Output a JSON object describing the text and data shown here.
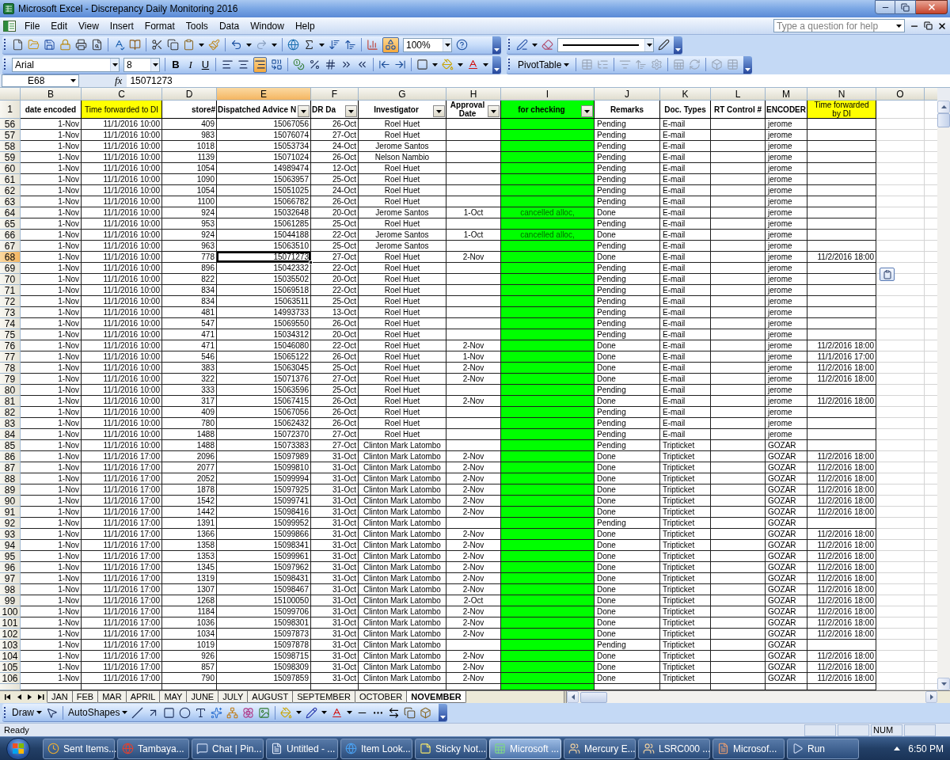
{
  "window": {
    "title": "Microsoft Excel - Discrepancy Daily Monitoring 2016"
  },
  "menu": [
    "File",
    "Edit",
    "View",
    "Insert",
    "Format",
    "Tools",
    "Data",
    "Window",
    "Help"
  ],
  "help_search": {
    "placeholder": "Type a question for help"
  },
  "standard_toolbar": {
    "zoom": "100%",
    "drawing_button": {
      "selected": true
    }
  },
  "formatting_toolbar": {
    "font": "Arial",
    "size": "8",
    "style_buttons": [
      "B",
      "I",
      "U"
    ],
    "align_buttons": [
      {
        "kind": "left",
        "selected": false
      },
      {
        "kind": "center",
        "selected": false
      },
      {
        "kind": "right",
        "selected": true
      }
    ]
  },
  "pivot_toolbar": {
    "label": "PivotTable"
  },
  "formula_bar": {
    "name_box": "E68",
    "function_label": "fx",
    "value": "15071273"
  },
  "header_row": {
    "row": "1"
  },
  "columns": [
    {
      "letter": "B",
      "heading": "date encoded",
      "selected": false,
      "filter": false
    },
    {
      "letter": "C",
      "heading": "Time forwarded to DI",
      "selected": false,
      "filter": false,
      "color": "#ffff00"
    },
    {
      "letter": "D",
      "heading": "store#",
      "selected": false,
      "filter": false
    },
    {
      "letter": "E",
      "heading": "Dispatched Advice N",
      "selected": true,
      "filter": true
    },
    {
      "letter": "F",
      "heading": "DR Da",
      "selected": false,
      "filter": true
    },
    {
      "letter": "G",
      "heading": "Investigator",
      "selected": false,
      "filter": true
    },
    {
      "letter": "H",
      "heading": "Approval Date",
      "selected": false,
      "filter": true
    },
    {
      "letter": "I",
      "heading": "for checking",
      "selected": false,
      "filter": true,
      "color": "#00ff00",
      "cell_fill": {
        "color": "#00ff00"
      }
    },
    {
      "letter": "J",
      "heading": "Remarks",
      "selected": false,
      "filter": false
    },
    {
      "letter": "K",
      "heading": "Doc. Types",
      "selected": false,
      "filter": false
    },
    {
      "letter": "L",
      "heading": "RT Control #",
      "selected": false,
      "filter": false
    },
    {
      "letter": "M",
      "heading": "ENCODER",
      "selected": false,
      "filter": false
    },
    {
      "letter": "N",
      "heading": "Time forwarded by DI",
      "selected": false,
      "filter": false,
      "color": "#ffff00"
    },
    {
      "letter": "O",
      "selected": false,
      "filter": false
    }
  ],
  "rows": [
    {
      "row": "56",
      "selected": false,
      "date_encoded": "1-Nov",
      "time_forwarded": "11/1/2016 10:00",
      "store": "409",
      "dispatched_advice": "15067056",
      "dr_date": "26-Oct",
      "investigator": "Roel Huet",
      "remarks": "Pending",
      "doc_type": "E-mail",
      "encoder": "jerome"
    },
    {
      "row": "57",
      "selected": false,
      "date_encoded": "1-Nov",
      "time_forwarded": "11/1/2016 10:00",
      "store": "983",
      "dispatched_advice": "15076074",
      "dr_date": "27-Oct",
      "investigator": "Roel Huet",
      "remarks": "Pending",
      "doc_type": "E-mail",
      "encoder": "jerome"
    },
    {
      "row": "58",
      "selected": false,
      "date_encoded": "1-Nov",
      "time_forwarded": "11/1/2016 10:00",
      "store": "1018",
      "dispatched_advice": "15053734",
      "dr_date": "24-Oct",
      "investigator": "Jerome Santos",
      "remarks": "Pending",
      "doc_type": "E-mail",
      "encoder": "jerome"
    },
    {
      "row": "59",
      "selected": false,
      "date_encoded": "1-Nov",
      "time_forwarded": "11/1/2016 10:00",
      "store": "1139",
      "dispatched_advice": "15071024",
      "dr_date": "26-Oct",
      "investigator": "Nelson Nambio",
      "remarks": "Pending",
      "doc_type": "E-mail",
      "encoder": "jerome"
    },
    {
      "row": "60",
      "selected": false,
      "date_encoded": "1-Nov",
      "time_forwarded": "11/1/2016 10:00",
      "store": "1054",
      "dispatched_advice": "14989474",
      "dr_date": "12-Oct",
      "investigator": "Roel Huet",
      "remarks": "Pending",
      "doc_type": "E-mail",
      "encoder": "jerome"
    },
    {
      "row": "61",
      "selected": false,
      "date_encoded": "1-Nov",
      "time_forwarded": "11/1/2016 10:00",
      "store": "1090",
      "dispatched_advice": "15063957",
      "dr_date": "25-Oct",
      "investigator": "Roel Huet",
      "remarks": "Pending",
      "doc_type": "E-mail",
      "encoder": "jerome"
    },
    {
      "row": "62",
      "selected": false,
      "date_encoded": "1-Nov",
      "time_forwarded": "11/1/2016 10:00",
      "store": "1054",
      "dispatched_advice": "15051025",
      "dr_date": "24-Oct",
      "investigator": "Roel Huet",
      "remarks": "Pending",
      "doc_type": "E-mail",
      "encoder": "jerome"
    },
    {
      "row": "63",
      "selected": false,
      "date_encoded": "1-Nov",
      "time_forwarded": "11/1/2016 10:00",
      "store": "1100",
      "dispatched_advice": "15066782",
      "dr_date": "26-Oct",
      "investigator": "Roel Huet",
      "remarks": "Pending",
      "doc_type": "E-mail",
      "encoder": "jerome"
    },
    {
      "row": "64",
      "selected": false,
      "date_encoded": "1-Nov",
      "time_forwarded": "11/1/2016 10:00",
      "store": "924",
      "dispatched_advice": "15032648",
      "dr_date": "20-Oct",
      "investigator": "Jerome Santos",
      "approval_date": "1-Oct",
      "for_checking": "cancelled alloc,",
      "remarks": "Done",
      "doc_type": "E-mail",
      "encoder": "jerome"
    },
    {
      "row": "65",
      "selected": false,
      "date_encoded": "1-Nov",
      "time_forwarded": "11/1/2016 10:00",
      "store": "953",
      "dispatched_advice": "15061285",
      "dr_date": "25-Oct",
      "investigator": "Roel Huet",
      "remarks": "Pending",
      "doc_type": "E-mail",
      "encoder": "jerome"
    },
    {
      "row": "66",
      "selected": false,
      "date_encoded": "1-Nov",
      "time_forwarded": "11/1/2016 10:00",
      "store": "924",
      "dispatched_advice": "15044188",
      "dr_date": "22-Oct",
      "investigator": "Jerome Santos",
      "approval_date": "1-Oct",
      "for_checking": "cancelled alloc,",
      "remarks": "Done",
      "doc_type": "E-mail",
      "encoder": "jerome"
    },
    {
      "row": "67",
      "selected": false,
      "date_encoded": "1-Nov",
      "time_forwarded": "11/1/2016 10:00",
      "store": "963",
      "dispatched_advice": "15063510",
      "dr_date": "25-Oct",
      "investigator": "Jerome Santos",
      "remarks": "Pending",
      "doc_type": "E-mail",
      "encoder": "jerome"
    },
    {
      "row": "68",
      "selected": true,
      "date_encoded": "1-Nov",
      "time_forwarded": "11/1/2016 10:00",
      "store": "778",
      "dispatched_advice": "15071273",
      "dr_date": "27-Oct",
      "investigator": "Roel Huet",
      "approval_date": "2-Nov",
      "remarks": "Done",
      "doc_type": "E-mail",
      "encoder": "jerome",
      "time_forwarded_by_di": "11/2/2016 18:00"
    },
    {
      "row": "69",
      "selected": false,
      "date_encoded": "1-Nov",
      "time_forwarded": "11/1/2016 10:00",
      "store": "896",
      "dispatched_advice": "15042332",
      "dr_date": "22-Oct",
      "investigator": "Roel Huet",
      "remarks": "Pending",
      "doc_type": "E-mail",
      "encoder": "jerome"
    },
    {
      "row": "70",
      "selected": false,
      "date_encoded": "1-Nov",
      "time_forwarded": "11/1/2016 10:00",
      "store": "822",
      "dispatched_advice": "15035502",
      "dr_date": "20-Oct",
      "investigator": "Roel Huet",
      "remarks": "Pending",
      "doc_type": "E-mail",
      "encoder": "jerome"
    },
    {
      "row": "71",
      "selected": false,
      "date_encoded": "1-Nov",
      "time_forwarded": "11/1/2016 10:00",
      "store": "834",
      "dispatched_advice": "15069518",
      "dr_date": "22-Oct",
      "investigator": "Roel Huet",
      "remarks": "Pending",
      "doc_type": "E-mail",
      "encoder": "jerome"
    },
    {
      "row": "72",
      "selected": false,
      "date_encoded": "1-Nov",
      "time_forwarded": "11/1/2016 10:00",
      "store": "834",
      "dispatched_advice": "15063511",
      "dr_date": "25-Oct",
      "investigator": "Roel Huet",
      "remarks": "Pending",
      "doc_type": "E-mail",
      "encoder": "jerome"
    },
    {
      "row": "73",
      "selected": false,
      "date_encoded": "1-Nov",
      "time_forwarded": "11/1/2016 10:00",
      "store": "481",
      "dispatched_advice": "14993733",
      "dr_date": "13-Oct",
      "investigator": "Roel Huet",
      "remarks": "Pending",
      "doc_type": "E-mail",
      "encoder": "jerome"
    },
    {
      "row": "74",
      "selected": false,
      "date_encoded": "1-Nov",
      "time_forwarded": "11/1/2016 10:00",
      "store": "547",
      "dispatched_advice": "15069550",
      "dr_date": "26-Oct",
      "investigator": "Roel Huet",
      "remarks": "Pending",
      "doc_type": "E-mail",
      "encoder": "jerome"
    },
    {
      "row": "75",
      "selected": false,
      "date_encoded": "1-Nov",
      "time_forwarded": "11/1/2016 10:00",
      "store": "471",
      "dispatched_advice": "15034312",
      "dr_date": "20-Oct",
      "investigator": "Roel Huet",
      "remarks": "Pending",
      "doc_type": "E-mail",
      "encoder": "jerome"
    },
    {
      "row": "76",
      "selected": false,
      "date_encoded": "1-Nov",
      "time_forwarded": "11/1/2016 10:00",
      "store": "471",
      "dispatched_advice": "15046080",
      "dr_date": "22-Oct",
      "investigator": "Roel Huet",
      "approval_date": "2-Nov",
      "remarks": "Done",
      "doc_type": "E-mail",
      "encoder": "jerome",
      "time_forwarded_by_di": "11/2/2016 18:00"
    },
    {
      "row": "77",
      "selected": false,
      "date_encoded": "1-Nov",
      "time_forwarded": "11/1/2016 10:00",
      "store": "546",
      "dispatched_advice": "15065122",
      "dr_date": "26-Oct",
      "investigator": "Roel Huet",
      "approval_date": "1-Nov",
      "remarks": "Done",
      "doc_type": "E-mail",
      "encoder": "jerome",
      "time_forwarded_by_di": "11/1/2016 17:00"
    },
    {
      "row": "78",
      "selected": false,
      "date_encoded": "1-Nov",
      "time_forwarded": "11/1/2016 10:00",
      "store": "383",
      "dispatched_advice": "15063045",
      "dr_date": "25-Oct",
      "investigator": "Roel Huet",
      "approval_date": "2-Nov",
      "remarks": "Done",
      "doc_type": "E-mail",
      "encoder": "jerome",
      "time_forwarded_by_di": "11/2/2016 18:00"
    },
    {
      "row": "79",
      "selected": false,
      "date_encoded": "1-Nov",
      "time_forwarded": "11/1/2016 10:00",
      "store": "322",
      "dispatched_advice": "15071376",
      "dr_date": "27-Oct",
      "investigator": "Roel Huet",
      "approval_date": "2-Nov",
      "remarks": "Done",
      "doc_type": "E-mail",
      "encoder": "jerome",
      "time_forwarded_by_di": "11/2/2016 18:00"
    },
    {
      "row": "80",
      "selected": false,
      "date_encoded": "1-Nov",
      "time_forwarded": "11/1/2016 10:00",
      "store": "333",
      "dispatched_advice": "15063596",
      "dr_date": "25-Oct",
      "investigator": "Roel Huet",
      "remarks": "Pending",
      "doc_type": "E-mail",
      "encoder": "jerome"
    },
    {
      "row": "81",
      "selected": false,
      "date_encoded": "1-Nov",
      "time_forwarded": "11/1/2016 10:00",
      "store": "317",
      "dispatched_advice": "15067415",
      "dr_date": "26-Oct",
      "investigator": "Roel Huet",
      "approval_date": "2-Nov",
      "remarks": "Done",
      "doc_type": "E-mail",
      "encoder": "jerome",
      "time_forwarded_by_di": "11/2/2016 18:00"
    },
    {
      "row": "82",
      "selected": false,
      "date_encoded": "1-Nov",
      "time_forwarded": "11/1/2016 10:00",
      "store": "409",
      "dispatched_advice": "15067056",
      "dr_date": "26-Oct",
      "investigator": "Roel Huet",
      "remarks": "Pending",
      "doc_type": "E-mail",
      "encoder": "jerome"
    },
    {
      "row": "83",
      "selected": false,
      "date_encoded": "1-Nov",
      "time_forwarded": "11/1/2016 10:00",
      "store": "780",
      "dispatched_advice": "15062432",
      "dr_date": "26-Oct",
      "investigator": "Roel Huet",
      "remarks": "Pending",
      "doc_type": "E-mail",
      "encoder": "jerome"
    },
    {
      "row": "84",
      "selected": false,
      "date_encoded": "1-Nov",
      "time_forwarded": "11/1/2016 10:00",
      "store": "1488",
      "dispatched_advice": "15072370",
      "dr_date": "27-Oct",
      "investigator": "Roel Huet",
      "remarks": "Pending",
      "doc_type": "E-mail",
      "encoder": "jerome"
    },
    {
      "row": "85",
      "selected": false,
      "date_encoded": "1-Nov",
      "time_forwarded": "11/1/2016 10:00",
      "store": "1488",
      "dispatched_advice": "15073383",
      "dr_date": "27-Oct",
      "investigator": "Clinton Mark Latombo",
      "remarks": "Pending",
      "doc_type": "Tripticket",
      "encoder": "GOZAR"
    },
    {
      "row": "86",
      "selected": false,
      "date_encoded": "1-Nov",
      "time_forwarded": "11/1/2016 17:00",
      "store": "2096",
      "dispatched_advice": "15097989",
      "dr_date": "31-Oct",
      "investigator": "Clinton Mark Latombo",
      "approval_date": "2-Nov",
      "remarks": "Done",
      "doc_type": "Tripticket",
      "encoder": "GOZAR",
      "time_forwarded_by_di": "11/2/2016 18:00"
    },
    {
      "row": "87",
      "selected": false,
      "date_encoded": "1-Nov",
      "time_forwarded": "11/1/2016 17:00",
      "store": "2077",
      "dispatched_advice": "15099810",
      "dr_date": "31-Oct",
      "investigator": "Clinton Mark Latombo",
      "approval_date": "2-Nov",
      "remarks": "Done",
      "doc_type": "Tripticket",
      "encoder": "GOZAR",
      "time_forwarded_by_di": "11/2/2016 18:00"
    },
    {
      "row": "88",
      "selected": false,
      "date_encoded": "1-Nov",
      "time_forwarded": "11/1/2016 17:00",
      "store": "2052",
      "dispatched_advice": "15099994",
      "dr_date": "31-Oct",
      "investigator": "Clinton Mark Latombo",
      "approval_date": "2-Nov",
      "remarks": "Done",
      "doc_type": "Tripticket",
      "encoder": "GOZAR",
      "time_forwarded_by_di": "11/2/2016 18:00"
    },
    {
      "row": "89",
      "selected": false,
      "date_encoded": "1-Nov",
      "time_forwarded": "11/1/2016 17:00",
      "store": "1878",
      "dispatched_advice": "15097925",
      "dr_date": "31-Oct",
      "investigator": "Clinton Mark Latombo",
      "approval_date": "2-Nov",
      "remarks": "Done",
      "doc_type": "Tripticket",
      "encoder": "GOZAR",
      "time_forwarded_by_di": "11/2/2016 18:00"
    },
    {
      "row": "90",
      "selected": false,
      "date_encoded": "1-Nov",
      "time_forwarded": "11/1/2016 17:00",
      "store": "1542",
      "dispatched_advice": "15099741",
      "dr_date": "31-Oct",
      "investigator": "Clinton Mark Latombo",
      "approval_date": "2-Nov",
      "remarks": "Done",
      "doc_type": "Tripticket",
      "encoder": "GOZAR",
      "time_forwarded_by_di": "11/2/2016 18:00"
    },
    {
      "row": "91",
      "selected": false,
      "date_encoded": "1-Nov",
      "time_forwarded": "11/1/2016 17:00",
      "store": "1442",
      "dispatched_advice": "15098416",
      "dr_date": "31-Oct",
      "investigator": "Clinton Mark Latombo",
      "approval_date": "2-Nov",
      "remarks": "Done",
      "doc_type": "Tripticket",
      "encoder": "GOZAR",
      "time_forwarded_by_di": "11/2/2016 18:00"
    },
    {
      "row": "92",
      "selected": false,
      "date_encoded": "1-Nov",
      "time_forwarded": "11/1/2016 17:00",
      "store": "1391",
      "dispatched_advice": "15099952",
      "dr_date": "31-Oct",
      "investigator": "Clinton Mark Latombo",
      "remarks": "Pending",
      "doc_type": "Tripticket",
      "encoder": "GOZAR"
    },
    {
      "row": "93",
      "selected": false,
      "date_encoded": "1-Nov",
      "time_forwarded": "11/1/2016 17:00",
      "store": "1366",
      "dispatched_advice": "15099866",
      "dr_date": "31-Oct",
      "investigator": "Clinton Mark Latombo",
      "approval_date": "2-Nov",
      "remarks": "Done",
      "doc_type": "Tripticket",
      "encoder": "GOZAR",
      "time_forwarded_by_di": "11/2/2016 18:00"
    },
    {
      "row": "94",
      "selected": false,
      "date_encoded": "1-Nov",
      "time_forwarded": "11/1/2016 17:00",
      "store": "1358",
      "dispatched_advice": "15098341",
      "dr_date": "31-Oct",
      "investigator": "Clinton Mark Latombo",
      "approval_date": "2-Nov",
      "remarks": "Done",
      "doc_type": "Tripticket",
      "encoder": "GOZAR",
      "time_forwarded_by_di": "11/2/2016 18:00"
    },
    {
      "row": "95",
      "selected": false,
      "date_encoded": "1-Nov",
      "time_forwarded": "11/1/2016 17:00",
      "store": "1353",
      "dispatched_advice": "15099961",
      "dr_date": "31-Oct",
      "investigator": "Clinton Mark Latombo",
      "approval_date": "2-Nov",
      "remarks": "Done",
      "doc_type": "Tripticket",
      "encoder": "GOZAR",
      "time_forwarded_by_di": "11/2/2016 18:00"
    },
    {
      "row": "96",
      "selected": false,
      "date_encoded": "1-Nov",
      "time_forwarded": "11/1/2016 17:00",
      "store": "1345",
      "dispatched_advice": "15097962",
      "dr_date": "31-Oct",
      "investigator": "Clinton Mark Latombo",
      "approval_date": "2-Nov",
      "remarks": "Done",
      "doc_type": "Tripticket",
      "encoder": "GOZAR",
      "time_forwarded_by_di": "11/2/2016 18:00"
    },
    {
      "row": "97",
      "selected": false,
      "date_encoded": "1-Nov",
      "time_forwarded": "11/1/2016 17:00",
      "store": "1319",
      "dispatched_advice": "15098431",
      "dr_date": "31-Oct",
      "investigator": "Clinton Mark Latombo",
      "approval_date": "2-Nov",
      "remarks": "Done",
      "doc_type": "Tripticket",
      "encoder": "GOZAR",
      "time_forwarded_by_di": "11/2/2016 18:00"
    },
    {
      "row": "98",
      "selected": false,
      "date_encoded": "1-Nov",
      "time_forwarded": "11/1/2016 17:00",
      "store": "1307",
      "dispatched_advice": "15098467",
      "dr_date": "31-Oct",
      "investigator": "Clinton Mark Latombo",
      "approval_date": "2-Nov",
      "remarks": "Done",
      "doc_type": "Tripticket",
      "encoder": "GOZAR",
      "time_forwarded_by_di": "11/2/2016 18:00"
    },
    {
      "row": "99",
      "selected": false,
      "date_encoded": "1-Nov",
      "time_forwarded": "11/1/2016 17:00",
      "store": "1268",
      "dispatched_advice": "15100050",
      "dr_date": "31-Oct",
      "investigator": "Clinton Mark Latombo",
      "approval_date": "2-Oct",
      "remarks": "Done",
      "doc_type": "Tripticket",
      "encoder": "GOZAR",
      "time_forwarded_by_di": "11/2/2016 18:00"
    },
    {
      "row": "100",
      "selected": false,
      "date_encoded": "1-Nov",
      "time_forwarded": "11/1/2016 17:00",
      "store": "1184",
      "dispatched_advice": "15099706",
      "dr_date": "31-Oct",
      "investigator": "Clinton Mark Latombo",
      "approval_date": "2-Nov",
      "remarks": "Done",
      "doc_type": "Tripticket",
      "encoder": "GOZAR",
      "time_forwarded_by_di": "11/2/2016 18:00"
    },
    {
      "row": "101",
      "selected": false,
      "date_encoded": "1-Nov",
      "time_forwarded": "11/1/2016 17:00",
      "store": "1036",
      "dispatched_advice": "15098301",
      "dr_date": "31-Oct",
      "investigator": "Clinton Mark Latombo",
      "approval_date": "2-Nov",
      "remarks": "Done",
      "doc_type": "Tripticket",
      "encoder": "GOZAR",
      "time_forwarded_by_di": "11/2/2016 18:00"
    },
    {
      "row": "102",
      "selected": false,
      "date_encoded": "1-Nov",
      "time_forwarded": "11/1/2016 17:00",
      "store": "1034",
      "dispatched_advice": "15097873",
      "dr_date": "31-Oct",
      "investigator": "Clinton Mark Latombo",
      "approval_date": "2-Nov",
      "remarks": "Done",
      "doc_type": "Tripticket",
      "encoder": "GOZAR",
      "time_forwarded_by_di": "11/2/2016 18:00"
    },
    {
      "row": "103",
      "selected": false,
      "date_encoded": "1-Nov",
      "time_forwarded": "11/1/2016 17:00",
      "store": "1019",
      "dispatched_advice": "15097878",
      "dr_date": "31-Oct",
      "investigator": "Clinton Mark Latombo",
      "remarks": "Pending",
      "doc_type": "Tripticket",
      "encoder": "GOZAR"
    },
    {
      "row": "104",
      "selected": false,
      "date_encoded": "1-Nov",
      "time_forwarded": "11/1/2016 17:00",
      "store": "926",
      "dispatched_advice": "15098715",
      "dr_date": "31-Oct",
      "investigator": "Clinton Mark Latombo",
      "approval_date": "2-Nov",
      "remarks": "Done",
      "doc_type": "Tripticket",
      "encoder": "GOZAR",
      "time_forwarded_by_di": "11/2/2016 18:00"
    },
    {
      "row": "105",
      "selected": false,
      "date_encoded": "1-Nov",
      "time_forwarded": "11/1/2016 17:00",
      "store": "857",
      "dispatched_advice": "15098309",
      "dr_date": "31-Oct",
      "investigator": "Clinton Mark Latombo",
      "approval_date": "2-Nov",
      "remarks": "Done",
      "doc_type": "Tripticket",
      "encoder": "GOZAR",
      "time_forwarded_by_di": "11/2/2016 18:00"
    },
    {
      "row": "106",
      "selected": false,
      "date_encoded": "1-Nov",
      "time_forwarded": "11/1/2016 17:00",
      "store": "790",
      "dispatched_advice": "15097859",
      "dr_date": "31-Oct",
      "investigator": "Clinton Mark Latombo",
      "approval_date": "2-Nov",
      "remarks": "Done",
      "doc_type": "Tripticket",
      "encoder": "GOZAR",
      "time_forwarded_by_di": "11/2/2016 18:00"
    }
  ],
  "sheet_tabs": [
    {
      "label": "JAN",
      "selected": false
    },
    {
      "label": "FEB",
      "selected": false
    },
    {
      "label": "MAR",
      "selected": false
    },
    {
      "label": "APRIL",
      "selected": false
    },
    {
      "label": "MAY",
      "selected": false
    },
    {
      "label": "JUNE",
      "selected": false
    },
    {
      "label": "JULY",
      "selected": false
    },
    {
      "label": "AUGUST",
      "selected": false
    },
    {
      "label": "SEPTEMBER",
      "selected": false
    },
    {
      "label": "OCTOBER",
      "selected": false
    },
    {
      "label": "NOVEMBER",
      "selected": true
    }
  ],
  "drawing_toolbar": {
    "draw": "Draw",
    "autoshapes": "AutoShapes"
  },
  "status_bar": {
    "status": "Ready",
    "num_lock": "NUM"
  },
  "taskbar": {
    "items": [
      {
        "label": "Sent Items...",
        "selected": false
      },
      {
        "label": "Tambaya...",
        "selected": false
      },
      {
        "label": "Chat | Pin...",
        "selected": false
      },
      {
        "label": "Untitled - ...",
        "selected": false
      },
      {
        "label": "Item Look...",
        "selected": false
      },
      {
        "label": "Sticky Not...",
        "selected": false
      },
      {
        "label": "Microsoft ...",
        "selected": true
      },
      {
        "label": "Mercury E...",
        "selected": false
      },
      {
        "label": "LSRC000 ...",
        "selected": false
      },
      {
        "label": "Microsof...",
        "selected": false
      },
      {
        "label": "Run",
        "selected": false
      }
    ],
    "clock": "6:50 PM"
  }
}
